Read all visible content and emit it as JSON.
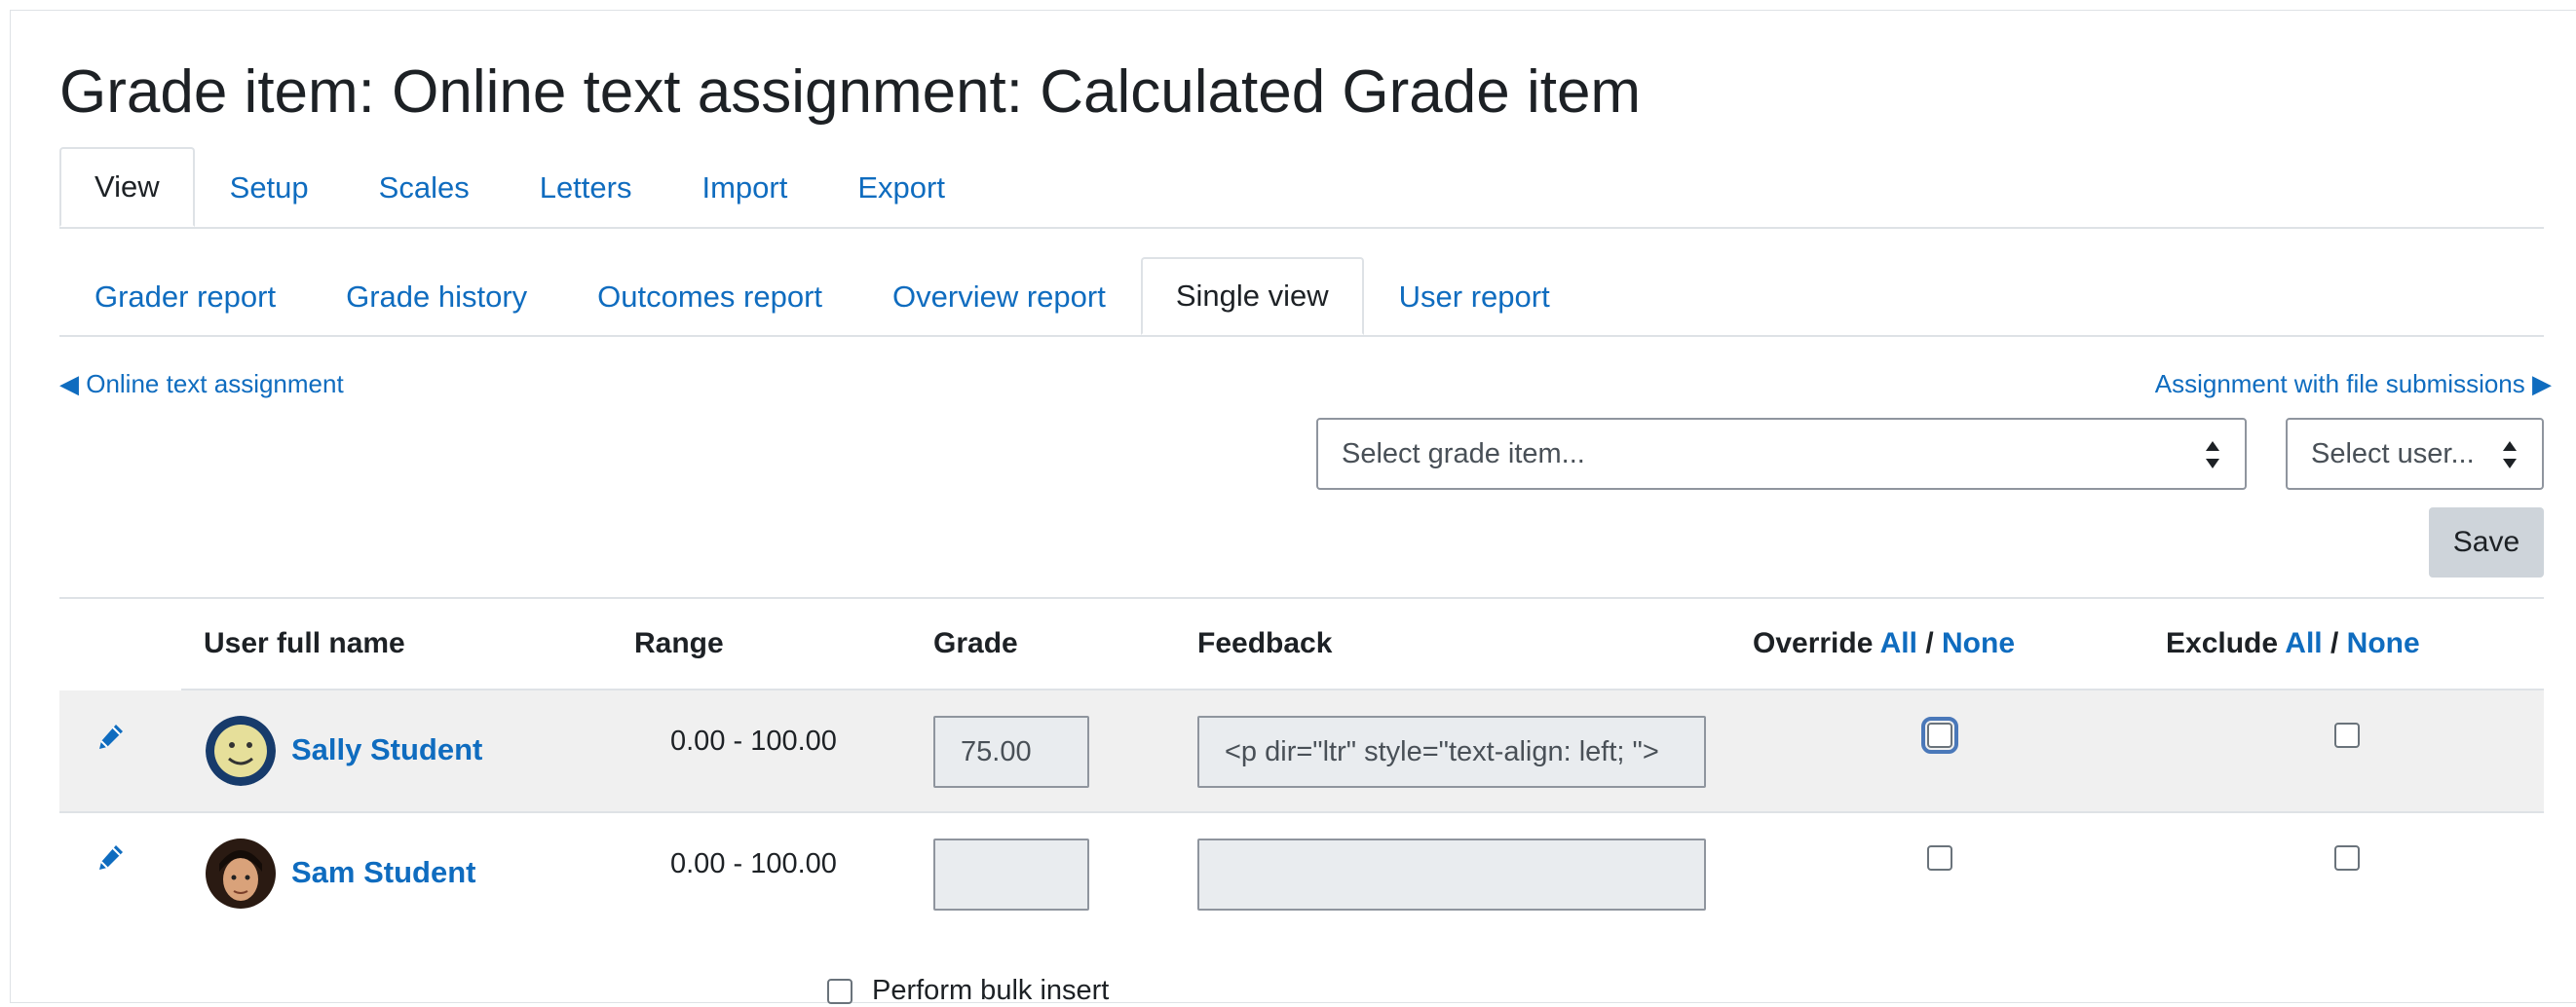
{
  "page": {
    "title": "Grade item: Online text assignment: Calculated Grade item"
  },
  "tabs_primary": [
    {
      "label": "View",
      "active": true
    },
    {
      "label": "Setup",
      "active": false
    },
    {
      "label": "Scales",
      "active": false
    },
    {
      "label": "Letters",
      "active": false
    },
    {
      "label": "Import",
      "active": false
    },
    {
      "label": "Export",
      "active": false
    }
  ],
  "tabs_secondary": [
    {
      "label": "Grader report",
      "active": false
    },
    {
      "label": "Grade history",
      "active": false
    },
    {
      "label": "Outcomes report",
      "active": false
    },
    {
      "label": "Overview report",
      "active": false
    },
    {
      "label": "Single view",
      "active": true
    },
    {
      "label": "User report",
      "active": false
    }
  ],
  "pager": {
    "prev": "◀ Online text assignment",
    "next": "Assignment with file submissions ▶"
  },
  "selectors": {
    "grade_item": "Select grade item...",
    "user": "Select user..."
  },
  "save_label": "Save",
  "table": {
    "headers": {
      "user": "User full name",
      "range": "Range",
      "grade": "Grade",
      "feedback": "Feedback",
      "override": "Override",
      "exclude": "Exclude",
      "all": "All",
      "none": "None",
      "sep": " / "
    },
    "rows": [
      {
        "name": "Sally Student",
        "range": "0.00 - 100.00",
        "grade": "75.00",
        "feedback": "<p dir=\"ltr\" style=\"text-align: left; \">",
        "override": false,
        "exclude": false
      },
      {
        "name": "Sam Student",
        "range": "0.00 - 100.00",
        "grade": "",
        "feedback": "",
        "override": false,
        "exclude": false
      }
    ]
  },
  "bulk_label": "Perform bulk insert",
  "colors": {
    "link": "#0f6cbf",
    "text": "#1d2125",
    "row_alt": "#f0f0f0",
    "button": "#ced4da"
  },
  "icons": [
    "pencil-icon",
    "avatar-sally",
    "avatar-sam",
    "up-down-arrows-icon"
  ]
}
